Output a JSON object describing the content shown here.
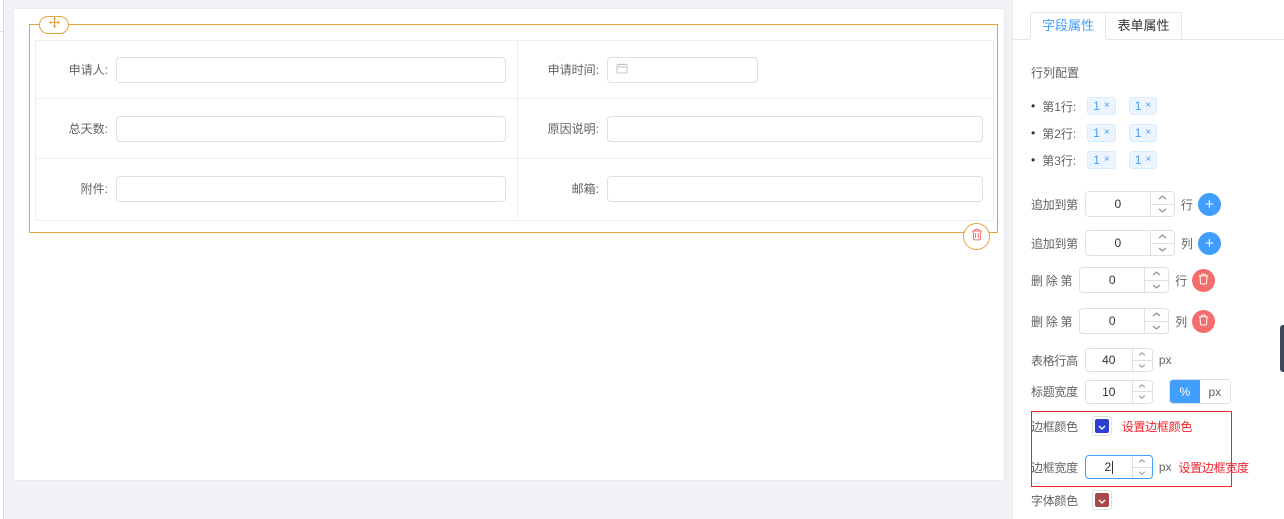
{
  "icons": {
    "plus": "+",
    "close": "×",
    "bullet": "•"
  },
  "colors": {
    "accent_blue": "#409eff",
    "warning_orange": "#e6a23c",
    "danger_red": "#f56c6c",
    "annotation_red": "#f5222d",
    "border_color_swatch": "#2e3ed0",
    "font_color_swatch": "#a84848"
  },
  "canvas": {
    "form_rows": [
      {
        "left_label": "申请人:",
        "right_label": "申请时间:"
      },
      {
        "left_label": "总天数:",
        "right_label": "原因说明:"
      },
      {
        "left_label": "附件:",
        "right_label": "邮箱:"
      }
    ]
  },
  "panel": {
    "tab_field": "字段属性",
    "tab_form": "表单属性",
    "row_config_title": "行列配置",
    "config_rows": [
      {
        "label": "第1行:",
        "tag1": "1",
        "tag2": "1"
      },
      {
        "label": "第2行:",
        "tag1": "1",
        "tag2": "1"
      },
      {
        "label": "第3行:",
        "tag1": "1",
        "tag2": "1"
      }
    ],
    "append_row": {
      "label": "追加到第",
      "value": "0",
      "suffix": "行"
    },
    "append_col": {
      "label": "追加到第",
      "value": "0",
      "suffix": "列"
    },
    "delete_row": {
      "label": "删 除 第",
      "value": "0",
      "suffix": "行"
    },
    "delete_col": {
      "label": "删 除 第",
      "value": "0",
      "suffix": "列"
    },
    "row_height": {
      "label": "表格行高",
      "value": "40",
      "suffix": "px"
    },
    "title_width": {
      "label": "标题宽度",
      "value": "10",
      "opt_percent": "%",
      "opt_px": "px",
      "selected": "%"
    },
    "border_color": {
      "label": "边框颜色",
      "annotation": "设置边框颜色"
    },
    "border_width": {
      "label": "边框宽度",
      "value": "2",
      "suffix": "px",
      "annotation": "设置边框宽度"
    },
    "font_color": {
      "label": "字体颜色"
    }
  }
}
